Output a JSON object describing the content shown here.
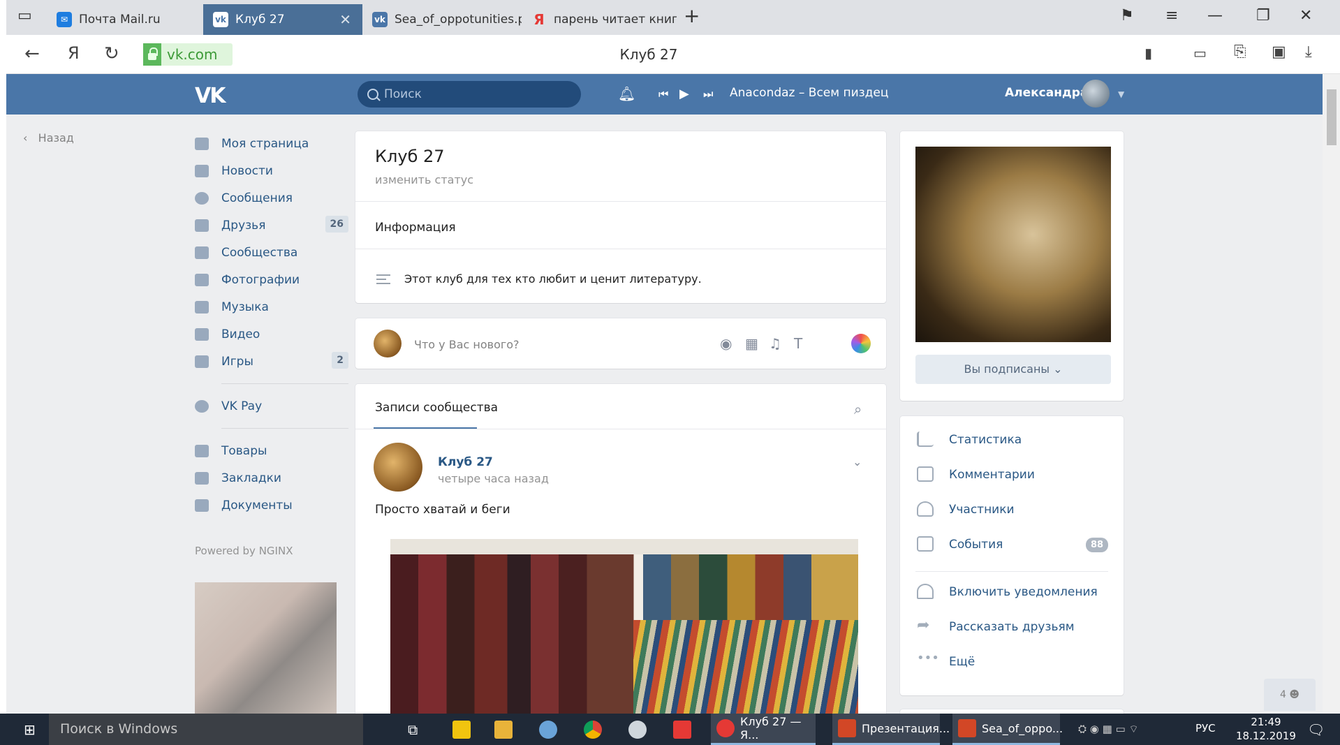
{
  "browser": {
    "tabs": [
      {
        "label": "Почта Mail.ru",
        "icon": "mail-icon",
        "active": false
      },
      {
        "label": "Клуб 27",
        "icon": "vk-icon",
        "active": true
      },
      {
        "label": "Sea_of_oppotunities.pptx",
        "icon": "vk-icon",
        "active": false
      },
      {
        "label": "парень читает книгу — Ян",
        "icon": "yandex-icon",
        "active": false
      }
    ],
    "url": "vk.com",
    "page_title": "Клуб 27",
    "yandex_glyph": "Я"
  },
  "vk": {
    "logo": "VK",
    "search_placeholder": "Поиск",
    "now_playing": "Anacondaz – Всем пиздец",
    "user_name": "Александра",
    "back": "Назад",
    "nav": [
      {
        "label": "Моя страница",
        "icon": "home-icon"
      },
      {
        "label": "Новости",
        "icon": "news-icon"
      },
      {
        "label": "Сообщения",
        "icon": "messages-icon"
      },
      {
        "label": "Друзья",
        "icon": "friends-icon",
        "count": "26"
      },
      {
        "label": "Сообщества",
        "icon": "communities-icon"
      },
      {
        "label": "Фотографии",
        "icon": "camera-icon"
      },
      {
        "label": "Музыка",
        "icon": "music-icon"
      },
      {
        "label": "Видео",
        "icon": "video-icon"
      },
      {
        "label": "Игры",
        "icon": "games-icon",
        "count": "2"
      }
    ],
    "nav2": [
      {
        "label": "VK Pay",
        "icon": "vkpay-icon"
      }
    ],
    "nav3": [
      {
        "label": "Товары",
        "icon": "shop-icon"
      },
      {
        "label": "Закладки",
        "icon": "star-icon"
      },
      {
        "label": "Документы",
        "icon": "document-icon"
      }
    ],
    "powered": "Powered by NGINX",
    "group": {
      "title": "Клуб 27",
      "status": "изменить статус",
      "info_label": "Информация",
      "description": "Этот клуб для тех кто любит и ценит литературу.",
      "new_post_placeholder": "Что у Вас нового?",
      "wall_tab": "Записи сообщества",
      "post": {
        "author": "Клуб 27",
        "time": "четыре часа назад",
        "text": "Просто хватай и беги"
      },
      "subscribed": "Вы подписаны",
      "menu": [
        {
          "label": "Статистика",
          "icon": "stats-icon"
        },
        {
          "label": "Комментарии",
          "icon": "comment-icon"
        },
        {
          "label": "Участники",
          "icon": "user-icon"
        },
        {
          "label": "События",
          "icon": "events-icon",
          "count": "88"
        },
        {
          "label": "Включить уведомления",
          "icon": "bell-icon"
        },
        {
          "label": "Рассказать друзьям",
          "icon": "share-icon"
        },
        {
          "label": "Ещё",
          "icon": "more-icon"
        }
      ]
    },
    "online_counter": "4"
  },
  "taskbar": {
    "search": "Поиск в Windows",
    "apps": [
      {
        "label": "Клуб 27 — Я...",
        "color": "#e53935"
      },
      {
        "label": "Презентация...",
        "color": "#d24726"
      },
      {
        "label": "Sea_of_oppo...",
        "color": "#d24726"
      }
    ],
    "lang": "РУС",
    "time": "21:49",
    "date": "18.12.2019"
  }
}
